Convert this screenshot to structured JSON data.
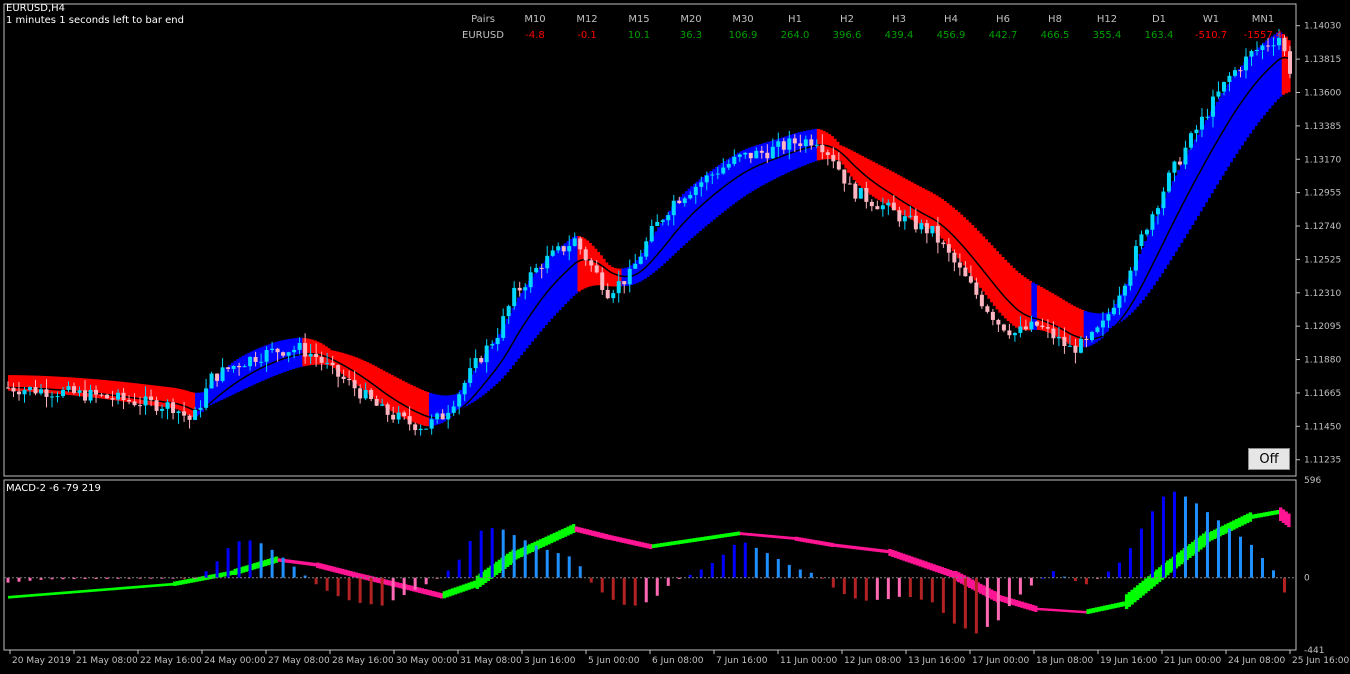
{
  "chart": {
    "symbol_label": "EURUSD,H4",
    "timer_text": "1 minutes 1 seconds left to bar end",
    "off_button_label": "Off",
    "price_ticks": [
      "1.14030",
      "1.13815",
      "1.13600",
      "1.13385",
      "1.13170",
      "1.12955",
      "1.12740",
      "1.12525",
      "1.12310",
      "1.12095",
      "1.11880",
      "1.11665",
      "1.11450",
      "1.11235"
    ],
    "ylim": [
      1.1113,
      1.1417
    ]
  },
  "table": {
    "header_label": "Pairs",
    "row_label": "EURUSD",
    "columns": [
      {
        "tf": "M10",
        "value": "-4.8",
        "color": "#ff0000"
      },
      {
        "tf": "M12",
        "value": "-0.1",
        "color": "#ff0000"
      },
      {
        "tf": "M15",
        "value": "10.1",
        "color": "#00a000"
      },
      {
        "tf": "M20",
        "value": "36.3",
        "color": "#00a000"
      },
      {
        "tf": "M30",
        "value": "106.9",
        "color": "#00a000"
      },
      {
        "tf": "H1",
        "value": "264.0",
        "color": "#00a000"
      },
      {
        "tf": "H2",
        "value": "396.6",
        "color": "#00a000"
      },
      {
        "tf": "H3",
        "value": "439.4",
        "color": "#00a000"
      },
      {
        "tf": "H4",
        "value": "456.9",
        "color": "#00a000"
      },
      {
        "tf": "H6",
        "value": "442.7",
        "color": "#00a000"
      },
      {
        "tf": "H8",
        "value": "466.5",
        "color": "#00a000"
      },
      {
        "tf": "H12",
        "value": "355.4",
        "color": "#00a000"
      },
      {
        "tf": "D1",
        "value": "163.4",
        "color": "#00a000"
      },
      {
        "tf": "W1",
        "value": "-510.7",
        "color": "#ff0000"
      },
      {
        "tf": "MN1",
        "value": "-1557.4",
        "color": "#ff0000"
      }
    ]
  },
  "macd": {
    "label": "MACD-2 -6 -79 219",
    "ticks": [
      "596",
      "0",
      "-441"
    ],
    "ylim": [
      -441,
      596
    ]
  },
  "time_labels": [
    "20 May 2019",
    "21 May 08:00",
    "22 May 16:00",
    "24 May 00:00",
    "27 May 08:00",
    "28 May 16:00",
    "30 May 00:00",
    "31 May 08:00",
    "3 Jun 16:00",
    "5 Jun 00:00",
    "6 Jun 08:00",
    "7 Jun 16:00",
    "11 Jun 00:00",
    "12 Jun 08:00",
    "13 Jun 16:00",
    "17 Jun 00:00",
    "18 Jun 08:00",
    "19 Jun 16:00",
    "21 Jun 00:00",
    "24 Jun 08:00",
    "25 Jun 16:00"
  ],
  "colors": {
    "bull_candle": "#00d8ff",
    "bear_candle": "#ffb6c1",
    "band_up": "#0000ff",
    "band_down": "#ff0000",
    "hist_pos_strong": "#0000ff",
    "hist_pos_weak": "#1e90ff",
    "hist_neg_strong": "#b22222",
    "hist_neg_weak": "#ff69b4",
    "signal_up": "#00ff00",
    "signal_down": "#ff1493",
    "grid": "#c0c0c0"
  },
  "chart_data": {
    "type": "candlestick",
    "x_start": "2019-05-20",
    "timeframe": "H4",
    "close_path": [
      [
        0,
        1.117
      ],
      [
        14,
        1.1168
      ],
      [
        30,
        1.1165
      ],
      [
        50,
        1.116
      ],
      [
        60,
        1.1158
      ],
      [
        67,
        1.1148
      ],
      [
        74,
        1.1176
      ],
      [
        82,
        1.1184
      ],
      [
        90,
        1.119
      ],
      [
        98,
        1.1194
      ],
      [
        106,
        1.1195
      ],
      [
        112,
        1.119
      ],
      [
        118,
        1.118
      ],
      [
        126,
        1.117
      ],
      [
        136,
        1.1155
      ],
      [
        146,
        1.1147
      ],
      [
        152,
        1.1145
      ],
      [
        158,
        1.1152
      ],
      [
        164,
        1.1167
      ],
      [
        170,
        1.1185
      ],
      [
        178,
        1.1205
      ],
      [
        184,
        1.123
      ],
      [
        194,
        1.125
      ],
      [
        206,
        1.1265
      ],
      [
        212,
        1.1248
      ],
      [
        218,
        1.1232
      ],
      [
        226,
        1.1242
      ],
      [
        234,
        1.127
      ],
      [
        242,
        1.129
      ],
      [
        250,
        1.13
      ],
      [
        258,
        1.131
      ],
      [
        266,
        1.1318
      ],
      [
        276,
        1.1322
      ],
      [
        286,
        1.1328
      ],
      [
        294,
        1.133
      ],
      [
        300,
        1.1318
      ],
      [
        306,
        1.1298
      ],
      [
        312,
        1.1292
      ],
      [
        320,
        1.1285
      ],
      [
        326,
        1.1278
      ],
      [
        336,
        1.127
      ],
      [
        344,
        1.125
      ],
      [
        352,
        1.123
      ],
      [
        360,
        1.1212
      ],
      [
        366,
        1.1205
      ],
      [
        374,
        1.121
      ],
      [
        380,
        1.1203
      ],
      [
        386,
        1.1195
      ],
      [
        392,
        1.1198
      ],
      [
        398,
        1.121
      ],
      [
        406,
        1.124
      ],
      [
        414,
        1.1275
      ],
      [
        422,
        1.1305
      ],
      [
        430,
        1.133
      ],
      [
        436,
        1.1348
      ],
      [
        444,
        1.137
      ],
      [
        452,
        1.1385
      ],
      [
        458,
        1.1392
      ],
      [
        462,
        1.1396
      ],
      [
        466,
        1.1375
      ]
    ],
    "macd_path": [
      [
        0,
        -30
      ],
      [
        14,
        -10
      ],
      [
        30,
        -8
      ],
      [
        50,
        -6
      ],
      [
        60,
        -4
      ],
      [
        67,
        -12
      ],
      [
        74,
        60
      ],
      [
        82,
        220
      ],
      [
        90,
        230
      ],
      [
        98,
        150
      ],
      [
        106,
        40
      ],
      [
        112,
        -40
      ],
      [
        118,
        -100
      ],
      [
        126,
        -150
      ],
      [
        136,
        -170
      ],
      [
        146,
        -90
      ],
      [
        152,
        -40
      ],
      [
        158,
        10
      ],
      [
        164,
        110
      ],
      [
        170,
        280
      ],
      [
        178,
        310
      ],
      [
        184,
        260
      ],
      [
        194,
        180
      ],
      [
        206,
        120
      ],
      [
        212,
        -30
      ],
      [
        218,
        -120
      ],
      [
        226,
        -180
      ],
      [
        234,
        -140
      ],
      [
        242,
        -20
      ],
      [
        250,
        30
      ],
      [
        258,
        110
      ],
      [
        266,
        230
      ],
      [
        276,
        150
      ],
      [
        286,
        60
      ],
      [
        294,
        20
      ],
      [
        300,
        -60
      ],
      [
        306,
        -120
      ],
      [
        312,
        -140
      ],
      [
        320,
        -130
      ],
      [
        326,
        -110
      ],
      [
        336,
        -150
      ],
      [
        344,
        -280
      ],
      [
        352,
        -340
      ],
      [
        360,
        -260
      ],
      [
        366,
        -130
      ],
      [
        374,
        -20
      ],
      [
        380,
        40
      ],
      [
        386,
        -10
      ],
      [
        392,
        -40
      ],
      [
        398,
        10
      ],
      [
        406,
        120
      ],
      [
        414,
        360
      ],
      [
        422,
        540
      ],
      [
        430,
        480
      ],
      [
        436,
        400
      ],
      [
        444,
        300
      ],
      [
        452,
        200
      ],
      [
        458,
        80
      ],
      [
        462,
        10
      ],
      [
        466,
        -190
      ]
    ],
    "signal_path": [
      [
        0,
        -120
      ],
      [
        30,
        -80
      ],
      [
        60,
        -40
      ],
      [
        82,
        30
      ],
      [
        98,
        110
      ],
      [
        112,
        80
      ],
      [
        126,
        20
      ],
      [
        146,
        -60
      ],
      [
        158,
        -110
      ],
      [
        170,
        -40
      ],
      [
        184,
        130
      ],
      [
        206,
        300
      ],
      [
        218,
        250
      ],
      [
        234,
        190
      ],
      [
        250,
        230
      ],
      [
        266,
        270
      ],
      [
        286,
        240
      ],
      [
        300,
        200
      ],
      [
        320,
        160
      ],
      [
        344,
        20
      ],
      [
        360,
        -120
      ],
      [
        374,
        -190
      ],
      [
        392,
        -210
      ],
      [
        406,
        -160
      ],
      [
        422,
        60
      ],
      [
        436,
        240
      ],
      [
        452,
        370
      ],
      [
        462,
        400
      ],
      [
        466,
        350
      ]
    ]
  }
}
